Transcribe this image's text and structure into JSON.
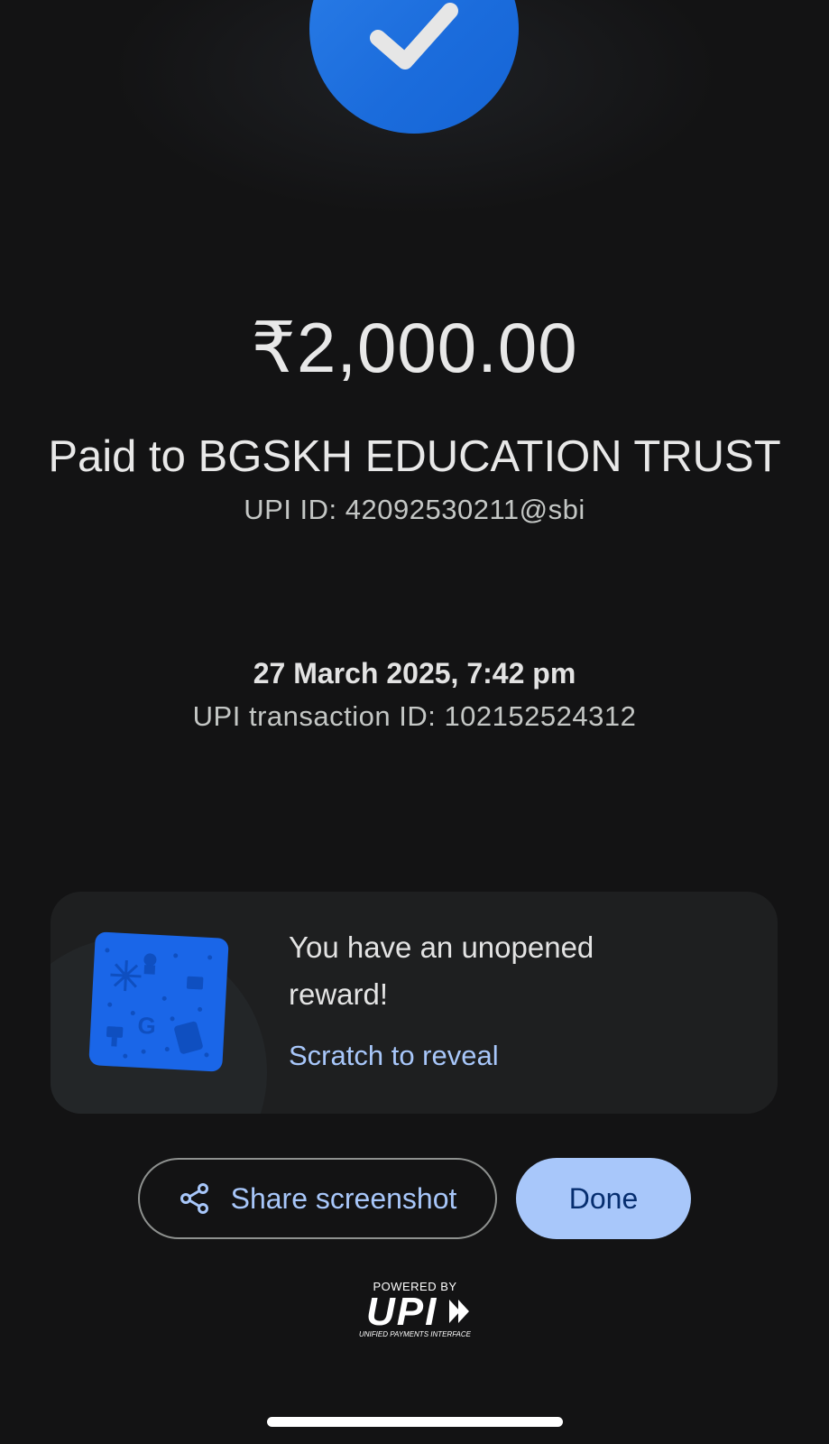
{
  "payment": {
    "amount": "₹2,000.00",
    "paid_to": "Paid to BGSKH EDUCATION TRUST",
    "upi_id": "UPI ID: 42092530211@sbi",
    "datetime": "27 March 2025, 7:42 pm",
    "transaction_id": "UPI transaction ID: 102152524312"
  },
  "reward": {
    "title": "You have an unopened reward!",
    "link": "Scratch to reveal"
  },
  "actions": {
    "share_label": "Share screenshot",
    "done_label": "Done"
  },
  "footer": {
    "powered_by": "POWERED BY",
    "upi_logo_text": "UPI",
    "upi_tagline": "UNIFIED PAYMENTS INTERFACE"
  },
  "icons": {
    "status": "check-icon",
    "share": "share-icon",
    "reward": "scratch-card-icon"
  },
  "colors": {
    "background": "#131314",
    "accent_blue": "#1a66e8",
    "link_blue": "#a8c7fa",
    "done_button": "#a8c7fa"
  }
}
